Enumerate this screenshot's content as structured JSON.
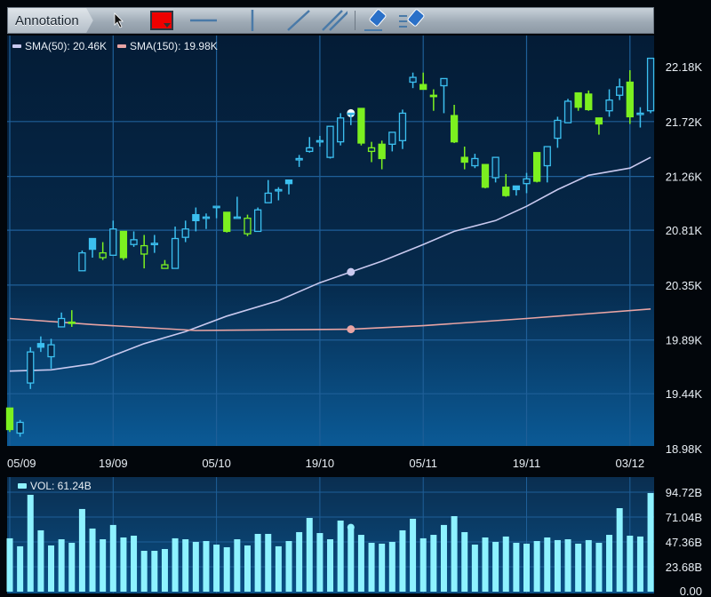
{
  "toolbar": {
    "annotation_label": "Annotation",
    "tools": [
      "pointer-tool",
      "color-picker",
      "horizontal-line-tool",
      "vertical-line-tool",
      "trend-line-tool",
      "parallel-channel-tool",
      "eraser-tool",
      "clear-all-tool"
    ],
    "selected_color": "#ee0000"
  },
  "legend": {
    "sma50": "SMA(50): 20.46K",
    "sma150": "SMA(150): 19.98K",
    "vol": "VOL: 61.24B"
  },
  "colors": {
    "up": "#3cc0f0",
    "down": "#7cf020",
    "sma50": "#c9c9ef",
    "sma150": "#e8a4a4",
    "volume": "#8ef2ff"
  },
  "chart_data": {
    "type": "candlestick",
    "price_axis": {
      "ylim": [
        18.98,
        22.18
      ],
      "ticks": [
        "22.18K",
        "21.72K",
        "21.26K",
        "20.81K",
        "20.35K",
        "19.89K",
        "19.44K",
        "18.98K"
      ],
      "tick_values": [
        22.18,
        21.72,
        21.26,
        20.81,
        20.35,
        19.89,
        19.44,
        18.98
      ]
    },
    "x_ticks": [
      {
        "index": 0,
        "label": "05/09"
      },
      {
        "index": 10,
        "label": "19/09"
      },
      {
        "index": 20,
        "label": "05/10"
      },
      {
        "index": 30,
        "label": "19/10"
      },
      {
        "index": 40,
        "label": "05/11"
      },
      {
        "index": 50,
        "label": "19/11"
      },
      {
        "index": 60,
        "label": "03/12"
      }
    ],
    "candles_ohlc": [
      [
        19.32,
        19.32,
        19.12,
        19.14,
        "g"
      ],
      [
        19.11,
        19.22,
        19.08,
        19.2,
        "c"
      ],
      [
        19.53,
        19.83,
        19.48,
        19.79,
        "c"
      ],
      [
        19.86,
        19.92,
        19.79,
        19.83,
        "c"
      ],
      [
        19.75,
        19.9,
        19.65,
        19.85,
        "c"
      ],
      [
        20.0,
        20.12,
        20.0,
        20.07,
        "c"
      ],
      [
        20.04,
        20.14,
        20.0,
        20.03,
        "g"
      ],
      [
        20.47,
        20.64,
        20.47,
        20.62,
        "c"
      ],
      [
        20.74,
        20.74,
        20.58,
        20.65,
        "c"
      ],
      [
        20.58,
        20.71,
        20.56,
        20.62,
        "g"
      ],
      [
        20.6,
        20.89,
        20.6,
        20.82,
        "c"
      ],
      [
        20.8,
        20.8,
        20.56,
        20.58,
        "g"
      ],
      [
        20.69,
        20.8,
        20.67,
        20.73,
        "c"
      ],
      [
        20.61,
        20.77,
        20.49,
        20.68,
        "g"
      ],
      [
        20.69,
        20.77,
        20.62,
        20.7,
        "c"
      ],
      [
        20.49,
        20.56,
        20.49,
        20.52,
        "g"
      ],
      [
        20.49,
        20.84,
        20.49,
        20.74,
        "c"
      ],
      [
        20.75,
        20.89,
        20.71,
        20.82,
        "c"
      ],
      [
        20.94,
        21.0,
        20.8,
        20.89,
        "c"
      ],
      [
        20.91,
        20.95,
        20.82,
        20.92,
        "c"
      ],
      [
        21.0,
        21.01,
        20.91,
        21.01,
        "c"
      ],
      [
        20.96,
        20.96,
        20.79,
        20.8,
        "g"
      ],
      [
        20.91,
        21.09,
        20.91,
        20.92,
        "c"
      ],
      [
        20.78,
        20.94,
        20.76,
        20.91,
        "g"
      ],
      [
        20.8,
        21.0,
        20.8,
        20.98,
        "c"
      ],
      [
        21.04,
        21.23,
        21.04,
        21.12,
        "c"
      ],
      [
        21.14,
        21.17,
        21.06,
        21.15,
        "c"
      ],
      [
        21.23,
        21.23,
        21.11,
        21.2,
        "c"
      ],
      [
        21.4,
        21.44,
        21.34,
        21.41,
        "c"
      ],
      [
        21.47,
        21.59,
        21.46,
        21.5,
        "c"
      ],
      [
        21.55,
        21.6,
        21.51,
        21.56,
        "c"
      ],
      [
        21.42,
        21.68,
        21.41,
        21.68,
        "c"
      ],
      [
        21.55,
        21.79,
        21.52,
        21.75,
        "c"
      ],
      [
        21.78,
        21.79,
        21.69,
        21.79,
        "c"
      ],
      [
        21.83,
        21.83,
        21.52,
        21.54,
        "g"
      ],
      [
        21.47,
        21.55,
        21.38,
        21.5,
        "g"
      ],
      [
        21.53,
        21.56,
        21.32,
        21.41,
        "g"
      ],
      [
        21.53,
        21.63,
        21.47,
        21.63,
        "c"
      ],
      [
        21.56,
        21.82,
        21.49,
        21.79,
        "c"
      ],
      [
        22.05,
        22.13,
        22.0,
        22.09,
        "c"
      ],
      [
        22.03,
        22.13,
        21.99,
        21.99,
        "g"
      ],
      [
        21.94,
        21.99,
        21.81,
        21.93,
        "g"
      ],
      [
        22.02,
        22.08,
        21.79,
        22.08,
        "c"
      ],
      [
        21.77,
        21.86,
        21.54,
        21.55,
        "g"
      ],
      [
        21.42,
        21.51,
        21.32,
        21.38,
        "g"
      ],
      [
        21.35,
        21.45,
        21.33,
        21.41,
        "c"
      ],
      [
        21.36,
        21.36,
        21.16,
        21.17,
        "g"
      ],
      [
        21.25,
        21.42,
        21.21,
        21.42,
        "c"
      ],
      [
        21.17,
        21.28,
        21.09,
        21.1,
        "g"
      ],
      [
        21.18,
        21.18,
        21.1,
        21.15,
        "c"
      ],
      [
        21.2,
        21.29,
        21.12,
        21.24,
        "c"
      ],
      [
        21.46,
        21.46,
        21.21,
        21.22,
        "g"
      ],
      [
        21.35,
        21.51,
        21.21,
        21.51,
        "c"
      ],
      [
        21.58,
        21.76,
        21.5,
        21.73,
        "c"
      ],
      [
        21.71,
        21.91,
        21.71,
        21.89,
        "c"
      ],
      [
        21.96,
        21.96,
        21.81,
        21.84,
        "g"
      ],
      [
        21.95,
        21.98,
        21.81,
        21.82,
        "g"
      ],
      [
        21.75,
        21.75,
        21.61,
        21.7,
        "g"
      ],
      [
        21.81,
        21.99,
        21.76,
        21.9,
        "c"
      ],
      [
        21.94,
        22.08,
        21.9,
        22.01,
        "c"
      ],
      [
        22.05,
        22.15,
        21.7,
        21.76,
        "g"
      ],
      [
        21.78,
        21.84,
        21.67,
        21.79,
        "c"
      ],
      [
        21.81,
        22.25,
        21.79,
        22.25,
        "c"
      ]
    ],
    "sma50": [
      [
        0,
        19.63
      ],
      [
        4,
        19.64
      ],
      [
        8,
        19.69
      ],
      [
        10,
        19.76
      ],
      [
        13,
        19.86
      ],
      [
        17,
        19.96
      ],
      [
        21,
        20.09
      ],
      [
        26,
        20.22
      ],
      [
        30,
        20.37
      ],
      [
        33,
        20.46
      ],
      [
        36,
        20.55
      ],
      [
        40,
        20.69
      ],
      [
        43,
        20.8
      ],
      [
        47,
        20.89
      ],
      [
        50,
        21.01
      ],
      [
        53,
        21.15
      ],
      [
        56,
        21.27
      ],
      [
        60,
        21.33
      ],
      [
        62,
        21.42
      ]
    ],
    "sma150": [
      [
        0,
        20.07
      ],
      [
        8,
        20.02
      ],
      [
        18,
        19.97
      ],
      [
        33,
        19.98
      ],
      [
        40,
        20.01
      ],
      [
        50,
        20.07
      ],
      [
        62,
        20.15
      ]
    ],
    "highlight_index": 33,
    "volume_axis": {
      "ylim": [
        0,
        94.72
      ],
      "ticks": [
        "94.72B",
        "71.04B",
        "47.36B",
        "23.68B",
        "0.00"
      ],
      "tick_values": [
        94.72,
        71.04,
        47.36,
        23.68,
        0
      ]
    },
    "volume": [
      50.8,
      43.2,
      92.2,
      58.4,
      44.0,
      49.9,
      46.5,
      78.7,
      60.1,
      49.9,
      63.5,
      51.6,
      53.3,
      38.9,
      38.9,
      40.6,
      50.8,
      49.9,
      47.4,
      48.2,
      44.8,
      42.3,
      49.9,
      44.0,
      55.0,
      55.0,
      43.2,
      48.2,
      56.7,
      70.2,
      55.8,
      49.9,
      67.7,
      61.24,
      54.1,
      46.5,
      45.7,
      47.4,
      58.4,
      69.4,
      50.8,
      54.1,
      63.5,
      71.9,
      56.7,
      44.8,
      51.6,
      47.4,
      52.5,
      46.5,
      45.7,
      48.2,
      51.6,
      49.1,
      49.9,
      45.7,
      49.1,
      46.5,
      54.1,
      79.5,
      53.3,
      52.5,
      93.9
    ]
  }
}
